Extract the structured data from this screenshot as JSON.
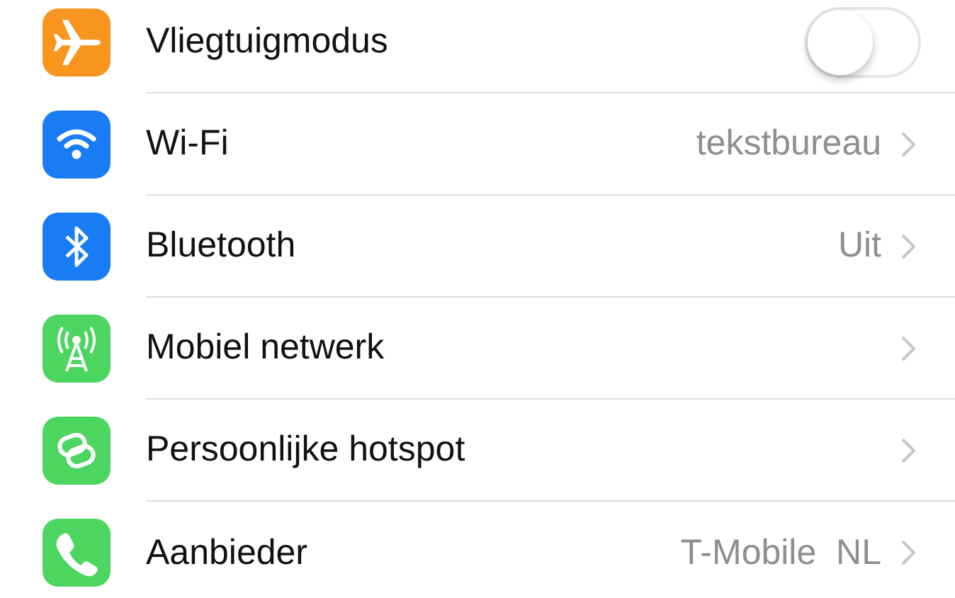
{
  "settings": [
    {
      "label": "Vliegtuigmodus",
      "color": "#f7951e",
      "kind": "switch",
      "on": false
    },
    {
      "label": "Wi-Fi",
      "color": "#1a7cf5",
      "kind": "link",
      "value": "tekstbureau"
    },
    {
      "label": "Bluetooth",
      "color": "#1a7cf5",
      "kind": "link",
      "value": "Uit"
    },
    {
      "label": "Mobiel netwerk",
      "color": "#4cd55f",
      "kind": "link"
    },
    {
      "label": "Persoonlijke hotspot",
      "color": "#4cd55f",
      "kind": "link"
    },
    {
      "label": "Aanbieder",
      "color": "#4cd55f",
      "kind": "link",
      "value": "T-Mobile  NL"
    }
  ]
}
